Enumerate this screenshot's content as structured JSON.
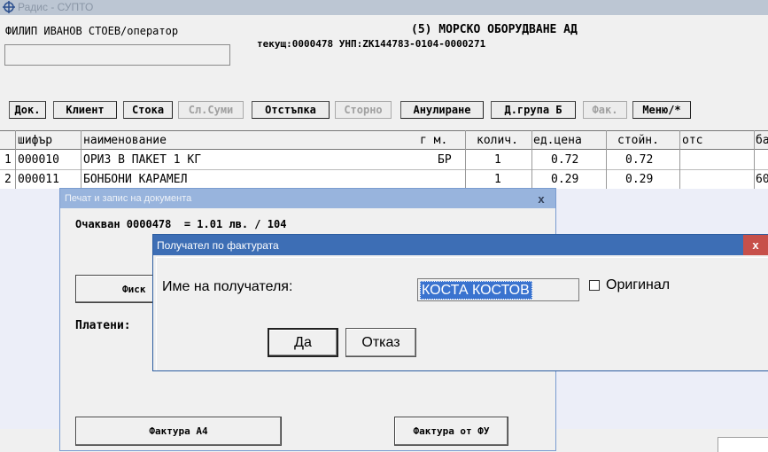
{
  "window": {
    "title": "Радис - СУПТО"
  },
  "header": {
    "operator": "ФИЛИП ИВАНОВ СТОЕВ/оператор",
    "company": "(5) МОРСКО ОБОРУДВАНЕ АД",
    "doc_info": "текущ:0000478 УНП:ZK144783-0104-0000271",
    "search_value": ""
  },
  "toolbar": [
    {
      "label": "Док.",
      "enabled": true
    },
    {
      "label": "Клиент",
      "enabled": true
    },
    {
      "label": "Стока",
      "enabled": true
    },
    {
      "label": "Сл.Суми",
      "enabled": false
    },
    {
      "label": "Отстъпка",
      "enabled": true
    },
    {
      "label": "Сторно",
      "enabled": false
    },
    {
      "label": "Анулиране",
      "enabled": true
    },
    {
      "label": "Д.група Б",
      "enabled": true
    },
    {
      "label": "Фак.",
      "enabled": false
    },
    {
      "label": "Меню/*",
      "enabled": true
    }
  ],
  "table": {
    "columns": [
      "шифър",
      "наименование",
      "г м.",
      "колич.",
      "ед.цена",
      "стойн.",
      "отс",
      "ба"
    ],
    "rows": [
      {
        "n": "1",
        "code": "000010",
        "name": "ОРИЗ В ПАКЕТ 1 КГ",
        "unit": "БР",
        "qty": "1",
        "price": "0.72",
        "total": "0.72",
        "disc": "",
        "extra": ""
      },
      {
        "n": "2",
        "code": "000011",
        "name": "БОНБОНИ КАРАМЕЛ",
        "unit": "",
        "qty": "1",
        "price": "0.29",
        "total": "0.29",
        "disc": "",
        "extra": "60"
      }
    ]
  },
  "print_dialog": {
    "title": "Печат и запис на документа",
    "close": "x",
    "expected": "Очакван 0000478  = 1.01 лв. / 104",
    "fiscal_label": "Фиск",
    "paid_label": "Платени:",
    "invoice_a4": "Фактура А4",
    "invoice_fu": "Фактура от ФУ"
  },
  "recipient_dialog": {
    "title": "Получател по фактурата",
    "close": "x",
    "name_label": "Име на получателя:",
    "name_value": "КОСТА КОСТОВ",
    "original_label": "Оригинал",
    "original_checked": false,
    "yes": "Да",
    "cancel": "Отказ"
  },
  "colors": {
    "active_title": "#3d6eb5",
    "inactive_title": "#98b4dd",
    "close_red": "#c7504a",
    "selection": "#3a73cf"
  }
}
